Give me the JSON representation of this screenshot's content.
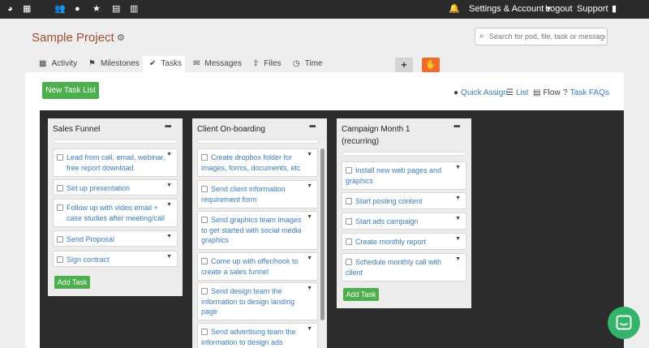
{
  "topbar": {
    "icons": [
      "pod-icon",
      "film-icon",
      "users-icon",
      "user-icon",
      "star-icon",
      "calendar-icon",
      "bar-chart-icon"
    ],
    "settings_label": "Settings & Account",
    "logout_label": "Logout",
    "support_label": "Support"
  },
  "header": {
    "project_title": "Sample Project",
    "search_placeholder": "Search for pod, file, task or message"
  },
  "tabs": [
    {
      "label": "Activity",
      "icon": "film-icon"
    },
    {
      "label": "Milestones",
      "icon": "flag-icon"
    },
    {
      "label": "Tasks",
      "icon": "check-icon",
      "active": true
    },
    {
      "label": "Messages",
      "icon": "envelope-icon"
    },
    {
      "label": "Files",
      "icon": "upload-icon"
    },
    {
      "label": "Time",
      "icon": "clock-icon"
    }
  ],
  "toolbar": {
    "new_task_list_label": "New Task List",
    "quick_assign_label": "Quick Assign",
    "list_label": "List",
    "flow_label": "Flow",
    "task_faqs_label": "Task FAQs"
  },
  "columns": [
    {
      "title": "Sales Funnel",
      "tasks": [
        "Lead from call, email, webinar, free report download",
        "Set up presentation",
        "Follow up with video email + case studies after meeting/call",
        "Send Proposal",
        "Sign contract"
      ],
      "add_task_label": "Add Task"
    },
    {
      "title": "Client On-boarding",
      "tasks": [
        "Create dropbox folder for images, forms, documents, etc",
        "Send client information requirement form",
        "Send graphics team images to get started with social media graphics",
        "Come up with offer/hook to create a sales funnel",
        "Send design team the information to design landing page",
        "Send advertising team the information to design ads"
      ]
    },
    {
      "title": "Campaign Month 1 (recurring)",
      "tasks": [
        "Install new web pages and graphics",
        "Start posting content",
        "Start ads campaign",
        "Create monthly report",
        "Schedule monthly call with client"
      ],
      "add_task_label": "Add Task"
    }
  ],
  "colors": {
    "topbar": "#2b2b2b",
    "project_title": "#a34d2c",
    "green": "#4cae4c",
    "orange": "#f06a2a",
    "link_blue": "#3b7bbf",
    "board": "#2c2c2c",
    "chat": "#34b36b"
  }
}
